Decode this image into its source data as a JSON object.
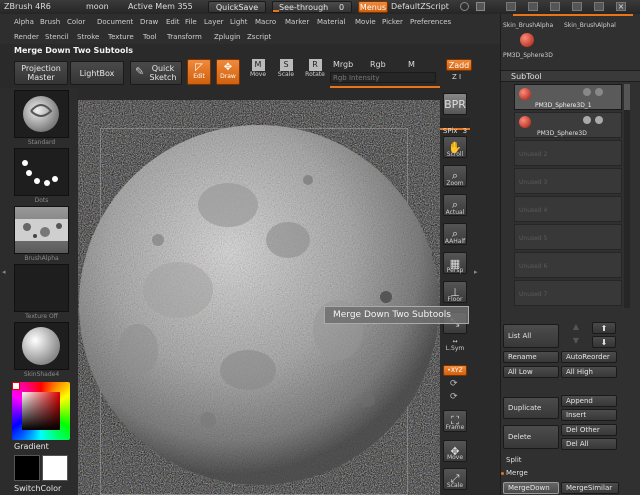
{
  "titlebar": {
    "app": "ZBrush 4R6",
    "doc": "moon",
    "mem": "Active Mem 355",
    "quicksave": "QuickSave",
    "seethrough": "See-through",
    "seethrough_value": "0",
    "menus": "Menus",
    "script": "DefaultZScript"
  },
  "menus_row1": [
    "Alpha",
    "Brush",
    "Color",
    "Document",
    "Draw",
    "Edit",
    "File",
    "Layer",
    "Light",
    "Macro",
    "Marker",
    "Material",
    "Movie",
    "Picker",
    "Preferences"
  ],
  "menus_row2": [
    "Render",
    "Stencil",
    "Stroke",
    "Texture",
    "Tool",
    "Transform",
    "Zplugin",
    "Zscript"
  ],
  "current_action": "Merge Down Two Subtools",
  "toolbar": {
    "projection_master": "Projection Master",
    "lightbox": "LightBox",
    "quick_sketch": "Quick Sketch",
    "edit": "Edit",
    "draw": "Draw",
    "move": "Move",
    "scale": "Scale",
    "rotate": "Rotate",
    "mrgb": "Mrgb",
    "rgb": "Rgb",
    "m": "M",
    "rgb_intensity": "Rgb Intensity",
    "zadd": "Zadd",
    "zi": "Z I"
  },
  "left_tray": {
    "standard": "Standard",
    "dots": "Dots",
    "brushalpha": "BrushAlpha",
    "texture_off": "Texture Off",
    "skinshade": "SkinShade4",
    "gradient": "Gradient",
    "switchcolor": "SwitchColor"
  },
  "shelf": {
    "bpr": "BPR",
    "spix": "SPix",
    "spix_value": "3",
    "scroll": "Scroll",
    "zoom": "Zoom",
    "actual": "Actual",
    "aahalf": "AAHalf",
    "persp": "Persp",
    "floor": "Floor",
    "lsym": "L.Sym",
    "xyz": "•XYZ",
    "frame": "Frame",
    "move": "Move",
    "scale": "Scale"
  },
  "tooltip": "Merge Down Two Subtools",
  "right_panel": {
    "tool_thumbs": [
      "Skin_BrushAlpha",
      "Skin_BrushAlphal",
      "PM3D_Sphere3D"
    ],
    "subtool_title": "SubTool",
    "subtools": [
      "PM3D_Sphere3D_1",
      "PM3D_Sphere3D"
    ],
    "unused": [
      "Unused 2",
      "Unused 3",
      "Unused 4",
      "Unused 5",
      "Unused 6",
      "Unused 7"
    ],
    "list_all": "List All",
    "rename": "Rename",
    "autoreorder": "AutoReorder",
    "all_low": "All Low",
    "all_high": "All High",
    "append": "Append",
    "duplicate": "Duplicate",
    "insert": "Insert",
    "del_other": "Del Other",
    "delete": "Delete",
    "del_all": "Del All",
    "split": "Split",
    "merge": "Merge",
    "mergedown": "MergeDown",
    "mergesimilar": "MergeSimilar"
  },
  "colors": {
    "accent": "#e8751a",
    "panel": "#303030",
    "canvas": "#000000"
  }
}
